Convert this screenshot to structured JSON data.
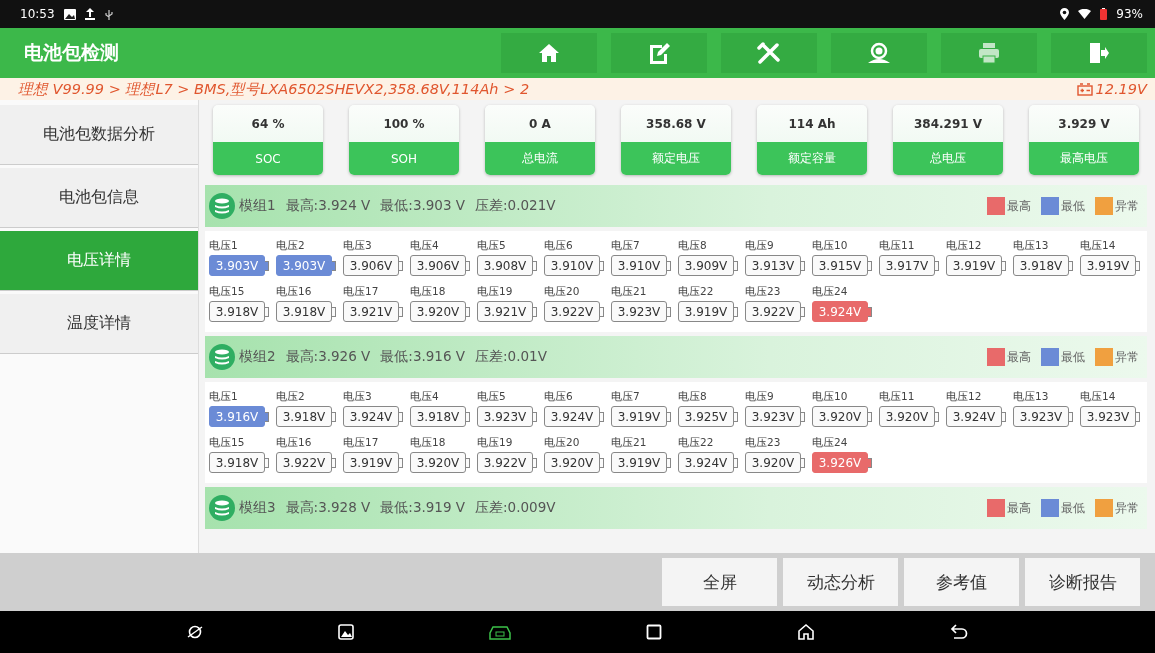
{
  "status_bar": {
    "time": "10:53",
    "battery": "93%"
  },
  "header": {
    "title": "电池包检测",
    "tools": [
      {
        "kind": "home",
        "disabled": false
      },
      {
        "kind": "edit",
        "disabled": false
      },
      {
        "kind": "tools",
        "disabled": false
      },
      {
        "kind": "support",
        "disabled": false
      },
      {
        "kind": "print",
        "disabled": true
      },
      {
        "kind": "exit",
        "disabled": false
      }
    ]
  },
  "breadcrumb": {
    "path": "理想 V99.99 > 理想L7  > BMS,型号LXA6502SHEVX2,358.68V,114Ah > 2",
    "voltage": "12.19V"
  },
  "sidebar": {
    "items": [
      {
        "label": "电池包数据分析",
        "selected": false
      },
      {
        "label": "电池包信息",
        "selected": false
      },
      {
        "label": "电压详情",
        "selected": true
      },
      {
        "label": "温度详情",
        "selected": false
      }
    ]
  },
  "stats": [
    {
      "value": "64 %",
      "label": "SOC"
    },
    {
      "value": "100 %",
      "label": "SOH"
    },
    {
      "value": "0 A",
      "label": "总电流"
    },
    {
      "value": "358.68 V",
      "label": "额定电压"
    },
    {
      "value": "114 Ah",
      "label": "额定容量"
    },
    {
      "value": "384.291 V",
      "label": "总电压"
    },
    {
      "value": "3.929 V",
      "label": "最高电压"
    }
  ],
  "modules": [
    {
      "name": "模组1",
      "max": "最高:3.924 V",
      "min": "最低:3.903 V",
      "diff": "压差:0.021V",
      "legend": [
        {
          "label": "最高",
          "color": "#e86a6a"
        },
        {
          "label": "最低",
          "color": "#6b8bd6"
        },
        {
          "label": "异常",
          "color": "#f0a040"
        }
      ],
      "cells": [
        {
          "label": "电压1",
          "value": "3.903V",
          "kind": "low"
        },
        {
          "label": "电压2",
          "value": "3.903V",
          "kind": "low"
        },
        {
          "label": "电压3",
          "value": "3.906V",
          "kind": "normal"
        },
        {
          "label": "电压4",
          "value": "3.906V",
          "kind": "normal"
        },
        {
          "label": "电压5",
          "value": "3.908V",
          "kind": "normal"
        },
        {
          "label": "电压6",
          "value": "3.910V",
          "kind": "normal"
        },
        {
          "label": "电压7",
          "value": "3.910V",
          "kind": "normal"
        },
        {
          "label": "电压8",
          "value": "3.909V",
          "kind": "normal"
        },
        {
          "label": "电压9",
          "value": "3.913V",
          "kind": "normal"
        },
        {
          "label": "电压10",
          "value": "3.915V",
          "kind": "normal"
        },
        {
          "label": "电压11",
          "value": "3.917V",
          "kind": "normal"
        },
        {
          "label": "电压12",
          "value": "3.919V",
          "kind": "normal"
        },
        {
          "label": "电压13",
          "value": "3.918V",
          "kind": "normal"
        },
        {
          "label": "电压14",
          "value": "3.919V",
          "kind": "normal"
        },
        {
          "label": "电压15",
          "value": "3.918V",
          "kind": "normal"
        },
        {
          "label": "电压16",
          "value": "3.918V",
          "kind": "normal"
        },
        {
          "label": "电压17",
          "value": "3.921V",
          "kind": "normal"
        },
        {
          "label": "电压18",
          "value": "3.920V",
          "kind": "normal"
        },
        {
          "label": "电压19",
          "value": "3.921V",
          "kind": "normal"
        },
        {
          "label": "电压20",
          "value": "3.922V",
          "kind": "normal"
        },
        {
          "label": "电压21",
          "value": "3.923V",
          "kind": "normal"
        },
        {
          "label": "电压22",
          "value": "3.919V",
          "kind": "normal"
        },
        {
          "label": "电压23",
          "value": "3.922V",
          "kind": "normal"
        },
        {
          "label": "电压24",
          "value": "3.924V",
          "kind": "high"
        }
      ]
    },
    {
      "name": "模组2",
      "max": "最高:3.926 V",
      "min": "最低:3.916 V",
      "diff": "压差:0.01V",
      "legend": [
        {
          "label": "最高",
          "color": "#e86a6a"
        },
        {
          "label": "最低",
          "color": "#6b8bd6"
        },
        {
          "label": "异常",
          "color": "#f0a040"
        }
      ],
      "cells": [
        {
          "label": "电压1",
          "value": "3.916V",
          "kind": "low"
        },
        {
          "label": "电压2",
          "value": "3.918V",
          "kind": "normal"
        },
        {
          "label": "电压3",
          "value": "3.924V",
          "kind": "normal"
        },
        {
          "label": "电压4",
          "value": "3.918V",
          "kind": "normal"
        },
        {
          "label": "电压5",
          "value": "3.923V",
          "kind": "normal"
        },
        {
          "label": "电压6",
          "value": "3.924V",
          "kind": "normal"
        },
        {
          "label": "电压7",
          "value": "3.919V",
          "kind": "normal"
        },
        {
          "label": "电压8",
          "value": "3.925V",
          "kind": "normal"
        },
        {
          "label": "电压9",
          "value": "3.923V",
          "kind": "normal"
        },
        {
          "label": "电压10",
          "value": "3.920V",
          "kind": "normal"
        },
        {
          "label": "电压11",
          "value": "3.920V",
          "kind": "normal"
        },
        {
          "label": "电压12",
          "value": "3.924V",
          "kind": "normal"
        },
        {
          "label": "电压13",
          "value": "3.923V",
          "kind": "normal"
        },
        {
          "label": "电压14",
          "value": "3.923V",
          "kind": "normal"
        },
        {
          "label": "电压15",
          "value": "3.918V",
          "kind": "normal"
        },
        {
          "label": "电压16",
          "value": "3.922V",
          "kind": "normal"
        },
        {
          "label": "电压17",
          "value": "3.919V",
          "kind": "normal"
        },
        {
          "label": "电压18",
          "value": "3.920V",
          "kind": "normal"
        },
        {
          "label": "电压19",
          "value": "3.922V",
          "kind": "normal"
        },
        {
          "label": "电压20",
          "value": "3.920V",
          "kind": "normal"
        },
        {
          "label": "电压21",
          "value": "3.919V",
          "kind": "normal"
        },
        {
          "label": "电压22",
          "value": "3.924V",
          "kind": "normal"
        },
        {
          "label": "电压23",
          "value": "3.920V",
          "kind": "normal"
        },
        {
          "label": "电压24",
          "value": "3.926V",
          "kind": "high"
        }
      ]
    },
    {
      "name": "模组3",
      "max": "最高:3.928 V",
      "min": "最低:3.919 V",
      "diff": "压差:0.009V",
      "legend": [
        {
          "label": "最高",
          "color": "#e86a6a"
        },
        {
          "label": "最低",
          "color": "#6b8bd6"
        },
        {
          "label": "异常",
          "color": "#f0a040"
        }
      ]
    }
  ],
  "actions": [
    "全屏",
    "动态分析",
    "参考值",
    "诊断报告"
  ]
}
